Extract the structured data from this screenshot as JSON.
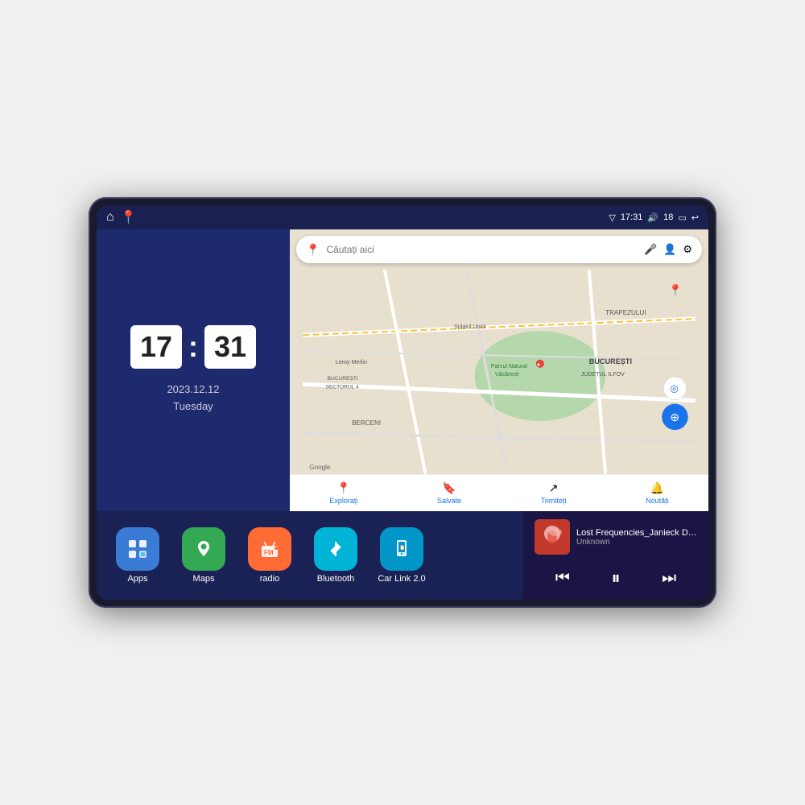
{
  "device": {
    "status_bar": {
      "left_icons": [
        "home",
        "location-pin"
      ],
      "time": "17:31",
      "signal_icon": "▽",
      "volume_icon": "🔊",
      "battery_level": "18",
      "battery_icon": "▭",
      "back_icon": "↩"
    },
    "clock": {
      "hour": "17",
      "minute": "31",
      "date": "2023.12.12",
      "day": "Tuesday"
    },
    "map": {
      "search_placeholder": "Căutați aici",
      "bottom_items": [
        {
          "label": "Explorați",
          "icon": "📍",
          "active": true
        },
        {
          "label": "Salvate",
          "icon": "🔖",
          "active": false
        },
        {
          "label": "Trimiteți",
          "icon": "↗",
          "active": false
        },
        {
          "label": "Noutăți",
          "icon": "🔔",
          "active": false
        }
      ],
      "labels": [
        "TRAPEZULUI",
        "BUCUREȘTI",
        "JUDEȚUL ILFOV",
        "BERCENI",
        "Parcul Natural Văcărești",
        "Leroy Merlin",
        "BUCUREȘTI SECTORUL 4",
        "Splaiul Unirii"
      ],
      "google_label": "Google"
    },
    "apps": [
      {
        "id": "apps",
        "label": "Apps",
        "icon": "⊞",
        "bg_class": "bg-blue"
      },
      {
        "id": "maps",
        "label": "Maps",
        "icon": "🗺",
        "bg_class": "bg-green"
      },
      {
        "id": "radio",
        "label": "radio",
        "icon": "📻",
        "bg_class": "bg-orange"
      },
      {
        "id": "bluetooth",
        "label": "Bluetooth",
        "icon": "🔷",
        "bg_class": "bg-teal"
      },
      {
        "id": "carlink",
        "label": "Car Link 2.0",
        "icon": "📱",
        "bg_class": "bg-cyan"
      }
    ],
    "music": {
      "title": "Lost Frequencies_Janieck Devy-...",
      "artist": "Unknown",
      "controls": {
        "prev": "⏮",
        "play": "⏸",
        "next": "⏭"
      }
    }
  }
}
